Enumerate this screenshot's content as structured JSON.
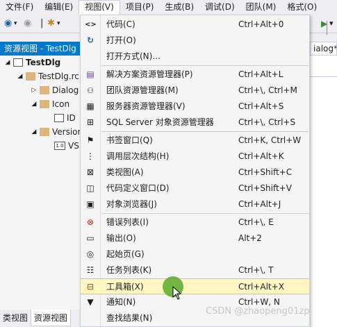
{
  "menubar": {
    "items": [
      "文件(F)",
      "编辑(E)",
      "视图(V)",
      "项目(P)",
      "生成(B)",
      "调试(D)",
      "团队(M)",
      "格式(O)"
    ],
    "active_index": 2
  },
  "toolbar": {
    "back_icon": "back-arrow-icon",
    "forward_icon": "forward-arrow-icon",
    "new_icon": "new-item-icon"
  },
  "left_panel": {
    "header": "资源视图 - TestDlg",
    "tree": [
      {
        "label": "TestDlg",
        "level": 0,
        "expander": "◢",
        "icon": "project-icon",
        "bold": true
      },
      {
        "label": "TestDlg.rc",
        "level": 1,
        "expander": "◢",
        "icon": "folder-icon"
      },
      {
        "label": "Dialog",
        "level": 2,
        "expander": "▷",
        "icon": "folder-icon"
      },
      {
        "label": "Icon",
        "level": 2,
        "expander": "◢",
        "icon": "folder-icon"
      },
      {
        "label": "ID",
        "level": 3,
        "expander": "",
        "icon": "icon-resource-icon"
      },
      {
        "label": "Version",
        "level": 2,
        "expander": "◢",
        "icon": "folder-icon"
      },
      {
        "label": "VS",
        "level": 3,
        "expander": "",
        "icon": "version-resource-icon"
      }
    ],
    "bottom_tabs": [
      "类视图",
      "资源视图"
    ],
    "active_bottom_tab": 1
  },
  "doc": {
    "tab_label": "ialog*"
  },
  "view_menu": {
    "items": [
      {
        "label": "代码(C)",
        "shortcut": "Ctrl+Alt+0",
        "icon": "code-icon",
        "glyph": "<>"
      },
      {
        "label": "打开(O)",
        "shortcut": "",
        "icon": "open-icon",
        "glyph": "↻"
      },
      {
        "label": "打开方式(N)...",
        "shortcut": "",
        "icon": "",
        "glyph": ""
      },
      {
        "label": "解决方案资源管理器(P)",
        "shortcut": "Ctrl+Alt+L",
        "icon": "solution-explorer-icon",
        "glyph": "▤",
        "sep_before": true
      },
      {
        "label": "团队资源管理器(M)",
        "shortcut": "Ctrl+\\, Ctrl+M",
        "icon": "team-explorer-icon",
        "glyph": "👥"
      },
      {
        "label": "服务器资源管理器(V)",
        "shortcut": "Ctrl+Alt+S",
        "icon": "server-explorer-icon",
        "glyph": "▦"
      },
      {
        "label": "SQL Server 对象资源管理器",
        "shortcut": "Ctrl+\\, Ctrl+S",
        "icon": "sql-server-icon",
        "glyph": "⊞"
      },
      {
        "label": "书签窗口(Q)",
        "shortcut": "Ctrl+K, Ctrl+W",
        "icon": "bookmark-icon",
        "glyph": "⚑",
        "sep_before": true
      },
      {
        "label": "调用层次结构(H)",
        "shortcut": "Ctrl+Alt+K",
        "icon": "call-hierarchy-icon",
        "glyph": "⋮"
      },
      {
        "label": "类视图(A)",
        "shortcut": "Ctrl+Shift+C",
        "icon": "class-view-icon",
        "glyph": "⊠"
      },
      {
        "label": "代码定义窗口(D)",
        "shortcut": "Ctrl+Shift+V",
        "icon": "code-definition-icon",
        "glyph": "◫"
      },
      {
        "label": "对象浏览器(J)",
        "shortcut": "Ctrl+Alt+J",
        "icon": "object-browser-icon",
        "glyph": "▣"
      },
      {
        "label": "错误列表(I)",
        "shortcut": "Ctrl+\\, E",
        "icon": "error-list-icon",
        "glyph": "⊗",
        "sep_before": true
      },
      {
        "label": "输出(O)",
        "shortcut": "Alt+2",
        "icon": "output-icon",
        "glyph": "▭"
      },
      {
        "label": "起始页(G)",
        "shortcut": "",
        "icon": "start-page-icon",
        "glyph": "◎"
      },
      {
        "label": "任务列表(K)",
        "shortcut": "Ctrl+\\, T",
        "icon": "task-list-icon",
        "glyph": "☷"
      },
      {
        "label": "工具箱(X)",
        "shortcut": "Ctrl+Alt+X",
        "icon": "toolbox-icon",
        "glyph": "🧰",
        "highlight": true
      },
      {
        "label": "通知(N)",
        "shortcut": "Ctrl+W, N",
        "icon": "notification-icon",
        "glyph": "▼"
      },
      {
        "label": "查找结果(N)",
        "shortcut": "",
        "icon": "",
        "glyph": ""
      }
    ]
  },
  "watermark": "CSDN @zhaopeng01zp",
  "colors": {
    "accent": "#007acc",
    "highlight_bg": "#fff6c4",
    "cursor": "#5aaa28"
  }
}
